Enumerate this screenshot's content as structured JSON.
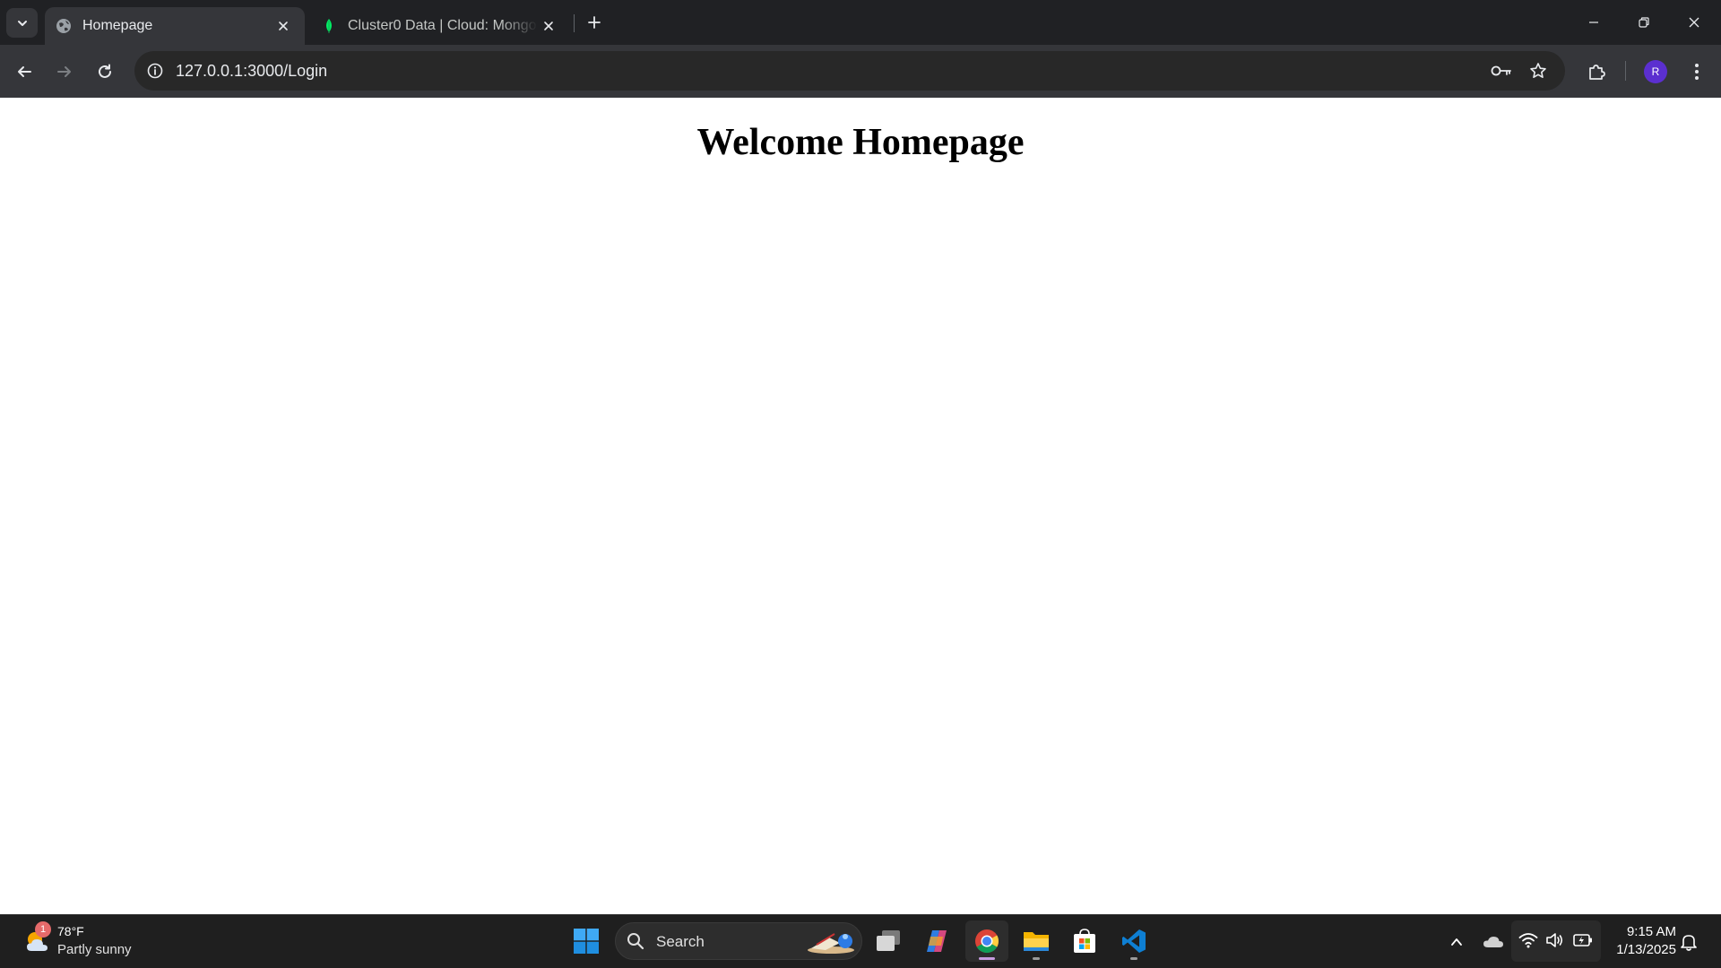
{
  "browser": {
    "tabs": [
      {
        "title": "Homepage",
        "favicon": "globe-icon",
        "active": true
      },
      {
        "title": "Cluster0 Data | Cloud: MongoDB Cloud",
        "favicon": "mongodb-leaf-icon",
        "active": false
      }
    ],
    "address_bar": {
      "url": "127.0.0.1:3000/Login"
    },
    "profile_initial": "R",
    "colors": {
      "tabstrip": "#202124",
      "toolbar": "#35363a",
      "omnibox": "#282828",
      "avatar": "#5b2fd0"
    }
  },
  "page": {
    "heading": "Welcome Homepage"
  },
  "taskbar": {
    "weather": {
      "temp": "78°F",
      "description": "Partly sunny",
      "badge": "1"
    },
    "search_label": "Search",
    "apps": [
      "windows-start-icon",
      "search-icon",
      "task-view-icon",
      "copilot-icon",
      "chrome-icon",
      "file-explorer-icon",
      "microsoft-store-icon",
      "vscode-icon"
    ],
    "clock": {
      "time": "9:15 AM",
      "date": "1/13/2025"
    }
  }
}
